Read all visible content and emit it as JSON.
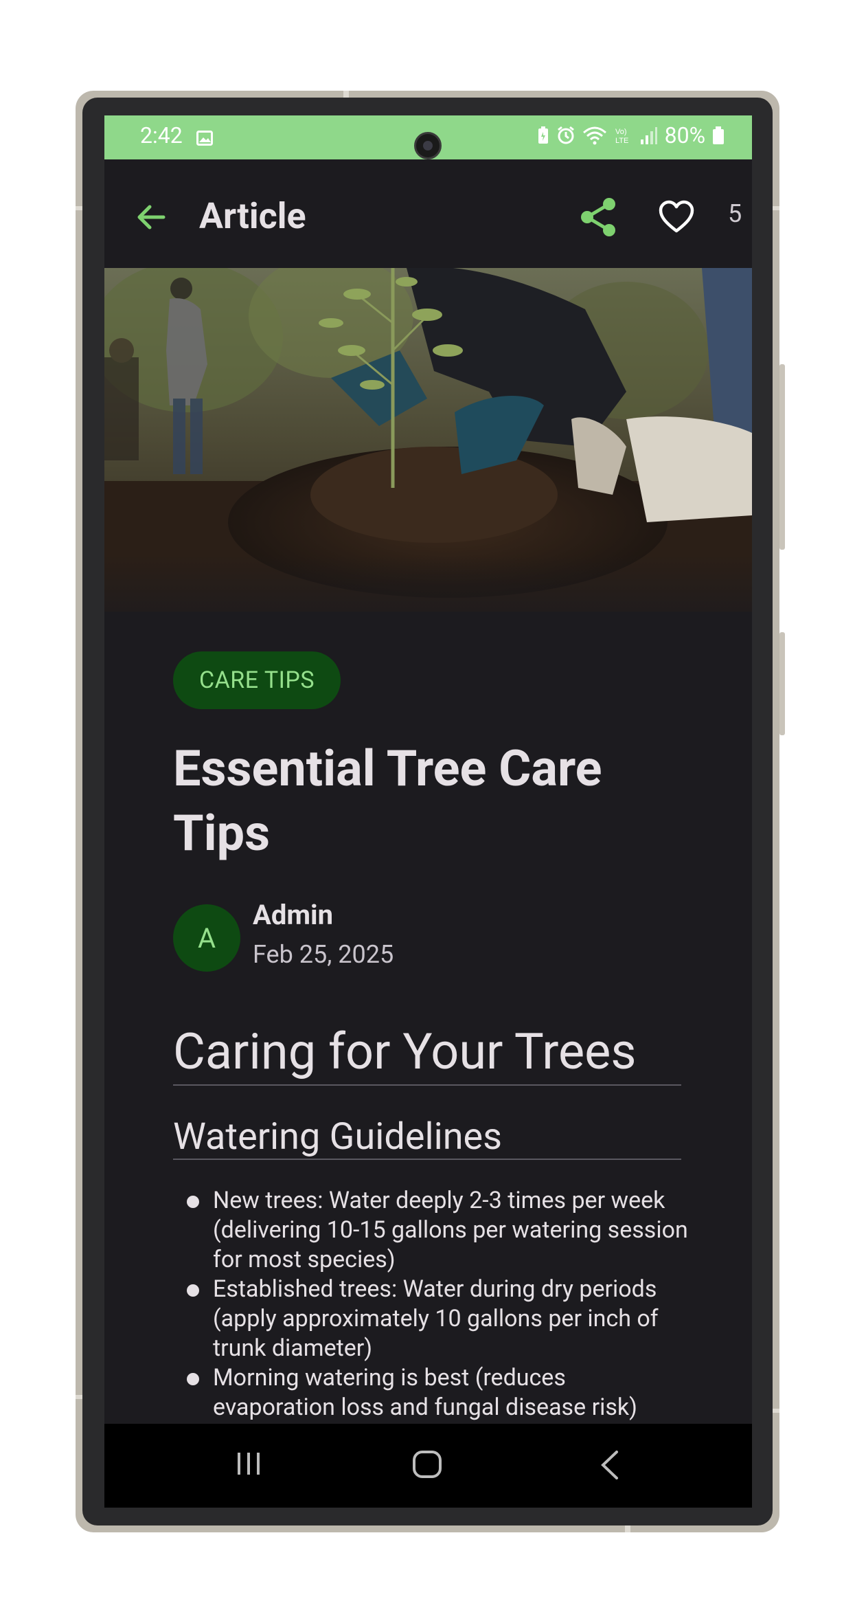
{
  "status_bar": {
    "time": "2:42",
    "battery": "80%",
    "icons": [
      "image-icon",
      "battery-saver-icon",
      "alarm-icon",
      "wifi-icon",
      "volte-icon",
      "signal-icon",
      "battery-icon"
    ],
    "background_color": "#8fd88a"
  },
  "app_bar": {
    "title": "Article",
    "like_count": "5",
    "icons": [
      "back-arrow-icon",
      "share-icon",
      "heart-icon"
    ],
    "accent_color": "#7ed16f"
  },
  "article": {
    "category": "CARE TIPS",
    "title": "Essential Tree Care Tips",
    "author_initial": "A",
    "author": "Admin",
    "date": "Feb 25, 2025",
    "heading": "Caring for Your Trees",
    "subheading": "Watering Guidelines",
    "bullets": [
      "New trees: Water deeply 2-3 times per week (delivering 10-15 gallons per watering session for most species)",
      "Established trees: Water during dry periods (apply approximately 10 gallons per inch of trunk diameter)",
      "Morning watering is best (reduces evaporation loss and fungal disease risk)"
    ]
  },
  "nav_bar": {
    "icons": [
      "recent-apps-icon",
      "home-icon",
      "back-icon"
    ]
  }
}
